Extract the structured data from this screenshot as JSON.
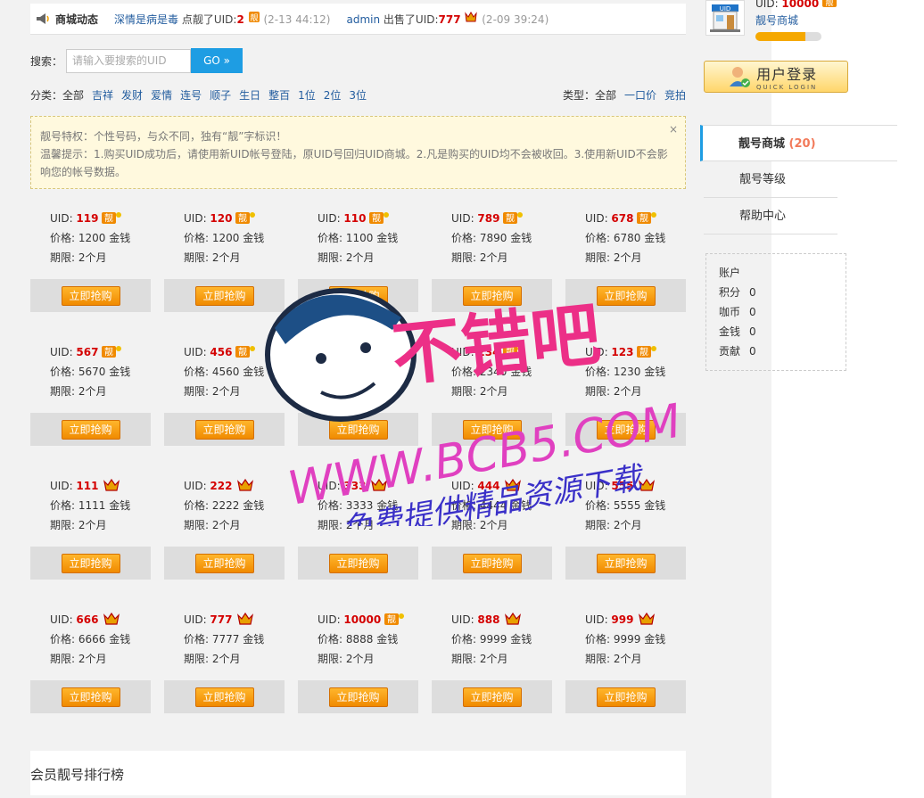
{
  "ticker": {
    "title": "商城动态",
    "events": [
      {
        "user": "深情是病是毒",
        "action": "点靓了UID:",
        "uid": "2",
        "time": "(2-13 44:12)"
      },
      {
        "user": "admin",
        "action": "出售了UID:",
        "uid": "777",
        "time": "(2-09 39:24)"
      }
    ]
  },
  "search": {
    "label": "搜索：",
    "placeholder": "请输入要搜索的UID",
    "button": "GO »"
  },
  "filters": {
    "category_label": "分类：",
    "categories": [
      "全部",
      "吉祥",
      "发财",
      "爱情",
      "连号",
      "顺子",
      "生日",
      "整百",
      "1位",
      "2位",
      "3位"
    ],
    "type_label": "类型：",
    "types": [
      "全部",
      "一口价",
      "竞拍"
    ]
  },
  "notice": {
    "line1": "靓号特权：个性号码，与众不同，独有“靓”字标识！",
    "line2": "温馨提示：1.购买UID成功后，请使用新UID帐号登陆，原UID号回归UID商城。2.凡是购买的UID均不会被收回。3.使用新UID不会影响您的帐号数据。",
    "close": "×"
  },
  "cards": [
    {
      "uid": "119",
      "price": "1200",
      "badge": "liang"
    },
    {
      "uid": "120",
      "price": "1200",
      "badge": "liang"
    },
    {
      "uid": "110",
      "price": "1100",
      "badge": "liang"
    },
    {
      "uid": "789",
      "price": "7890",
      "badge": "liang"
    },
    {
      "uid": "678",
      "price": "6780",
      "badge": "liang"
    },
    {
      "uid": "567",
      "price": "5670",
      "badge": "liang"
    },
    {
      "uid": "456",
      "price": "4560",
      "badge": "liang"
    },
    {
      "uid": "345",
      "price": "3450",
      "badge": "liang"
    },
    {
      "uid": "234",
      "price": "2340",
      "badge": "liang"
    },
    {
      "uid": "123",
      "price": "1230",
      "badge": "liang"
    },
    {
      "uid": "111",
      "price": "1111",
      "badge": "crown"
    },
    {
      "uid": "222",
      "price": "2222",
      "badge": "crown"
    },
    {
      "uid": "333",
      "price": "3333",
      "badge": "crown"
    },
    {
      "uid": "444",
      "price": "4444",
      "badge": "crown"
    },
    {
      "uid": "555",
      "price": "5555",
      "badge": "crown"
    },
    {
      "uid": "666",
      "price": "6666",
      "badge": "crown"
    },
    {
      "uid": "777",
      "price": "7777",
      "badge": "crown"
    },
    {
      "uid": "10000",
      "price": "8888",
      "badge": "liang"
    },
    {
      "uid": "888",
      "price": "9999",
      "badge": "crown"
    },
    {
      "uid": "999",
      "price": "9999",
      "badge": "crown"
    }
  ],
  "card_labels": {
    "uid_prefix": "UID: ",
    "price_prefix": "价格: ",
    "price_unit": " 金钱",
    "term": "期限: 2个月",
    "buy": "立即抢购"
  },
  "rank_title": "会员靓号排行榜",
  "sidebar": {
    "uid_label": "UID: ",
    "uid": "10000",
    "shop_name": "靓号商城",
    "level_progress": 0.75,
    "login_title": "用户登录",
    "login_sub": "QUICK LOGIN",
    "menu": [
      {
        "label": "靓号商城",
        "count": "(20)"
      },
      {
        "label": "靓号等级"
      },
      {
        "label": "帮助中心"
      }
    ],
    "account": {
      "title": "账户",
      "rows": [
        {
          "k": "积分",
          "v": "0"
        },
        {
          "k": "咖币",
          "v": "0"
        },
        {
          "k": "金钱",
          "v": "0"
        },
        {
          "k": "贡献",
          "v": "0"
        }
      ]
    }
  },
  "watermark": {
    "text1": "不错吧",
    "text2": "WWW.BCB5.COM",
    "text3": "免费提供精品资源下载"
  },
  "colors": {
    "accent": "#1e9de3",
    "price_red": "#d40000",
    "buy_orange": "#f5a000",
    "link_blue": "#235d9f"
  }
}
